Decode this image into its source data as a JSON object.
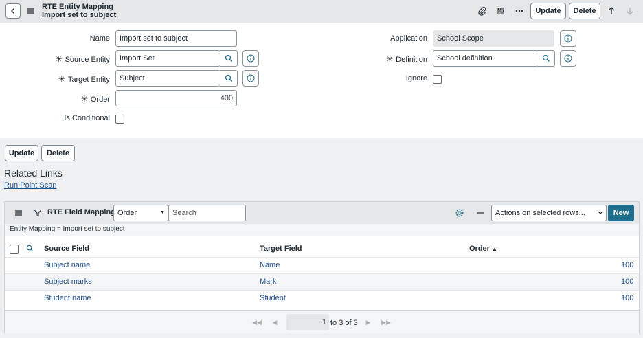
{
  "header": {
    "title_line1": "RTE Entity Mapping",
    "title_line2": "Import set to subject",
    "update_label": "Update",
    "delete_label": "Delete"
  },
  "form": {
    "name": {
      "label": "Name",
      "value": "Import set to subject"
    },
    "source_entity": {
      "label": "Source Entity",
      "value": "Import Set"
    },
    "target_entity": {
      "label": "Target Entity",
      "value": "Subject"
    },
    "order": {
      "label": "Order",
      "value": "400"
    },
    "is_conditional": {
      "label": "Is Conditional",
      "checked": false
    },
    "application": {
      "label": "Application",
      "value": "School Scope"
    },
    "definition": {
      "label": "Definition",
      "value": "School definition"
    },
    "ignore": {
      "label": "Ignore",
      "checked": false
    },
    "required_mark": "✳"
  },
  "actions": {
    "update_label": "Update",
    "delete_label": "Delete"
  },
  "related_links": {
    "title": "Related Links",
    "items": [
      "Run Point Scan"
    ]
  },
  "related_list": {
    "title": "RTE Field Mappings",
    "search_field": "Order",
    "search_placeholder": "Search",
    "actions_select": "Actions on selected rows...",
    "new_label": "New",
    "filter": "Entity Mapping = Import set to subject",
    "columns": [
      "Source Field",
      "Target Field",
      "Order"
    ],
    "sort_indicator": "▲",
    "rows": [
      {
        "source": "Subject name",
        "target": "Name",
        "order": "100"
      },
      {
        "source": "Subject marks",
        "target": "Mark",
        "order": "100"
      },
      {
        "source": "Student name",
        "target": "Student",
        "order": "100"
      }
    ],
    "pagination": {
      "current": "1",
      "total": "to 3 of 3"
    }
  },
  "colors": {
    "accent": "#1f6e8c",
    "link": "#1f4e8a",
    "header_bg": "#e4e6e7"
  }
}
